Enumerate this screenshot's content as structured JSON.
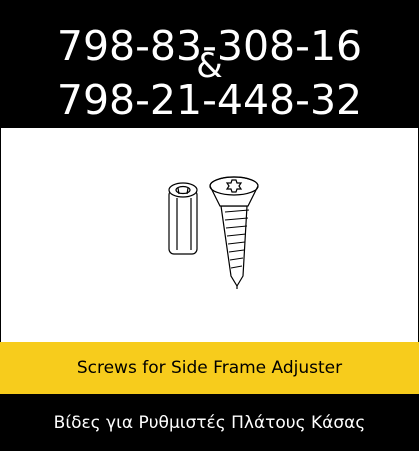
{
  "header": {
    "code_1": "798-83-308-16",
    "separator": "&",
    "code_2": "798-21-448-32"
  },
  "illustration": {
    "items": [
      "spacer-sleeve-icon",
      "countersunk-screw-icon"
    ]
  },
  "captions": {
    "english": "Screws for Side Frame Adjuster",
    "greek": "Βίδες για Ρυθμιστές Πλάτους Κάσας"
  },
  "colors": {
    "header_bg": "#000000",
    "accent_yellow": "#f7cc1c",
    "footer_bg": "#000000",
    "text_light": "#ffffff",
    "text_dark": "#000000"
  }
}
